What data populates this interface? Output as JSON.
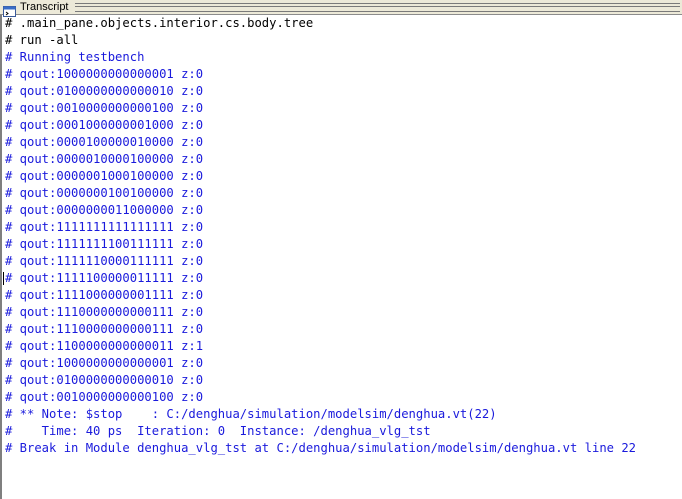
{
  "window": {
    "title": "Transcript"
  },
  "transcript": {
    "lines": [
      {
        "text": "# .main_pane.objects.interior.cs.body.tree",
        "color": "black"
      },
      {
        "text": "# run -all",
        "color": "black"
      },
      {
        "text": "# Running testbench",
        "color": "blue"
      },
      {
        "text": "# qout:1000000000000001 z:0",
        "color": "blue"
      },
      {
        "text": "# qout:0100000000000010 z:0",
        "color": "blue"
      },
      {
        "text": "# qout:0010000000000100 z:0",
        "color": "blue"
      },
      {
        "text": "# qout:0001000000001000 z:0",
        "color": "blue"
      },
      {
        "text": "# qout:0000100000010000 z:0",
        "color": "blue"
      },
      {
        "text": "# qout:0000010000100000 z:0",
        "color": "blue"
      },
      {
        "text": "# qout:0000001000100000 z:0",
        "color": "blue"
      },
      {
        "text": "# qout:0000000100100000 z:0",
        "color": "blue"
      },
      {
        "text": "# qout:0000000011000000 z:0",
        "color": "blue"
      },
      {
        "text": "# qout:1111111111111111 z:0",
        "color": "blue"
      },
      {
        "text": "# qout:1111111100111111 z:0",
        "color": "blue"
      },
      {
        "text": "# qout:1111110000111111 z:0",
        "color": "blue"
      },
      {
        "text": "# qout:1111100000011111 z:0",
        "color": "blue"
      },
      {
        "text": "# qout:1111000000001111 z:0",
        "color": "blue"
      },
      {
        "text": "# qout:1110000000000111 z:0",
        "color": "blue"
      },
      {
        "text": "# qout:1110000000000111 z:0",
        "color": "blue"
      },
      {
        "text": "# qout:1100000000000011 z:1",
        "color": "blue"
      },
      {
        "text": "# qout:1000000000000001 z:0",
        "color": "blue"
      },
      {
        "text": "# qout:0100000000000010 z:0",
        "color": "blue"
      },
      {
        "text": "# qout:0010000000000100 z:0",
        "color": "blue"
      },
      {
        "text": "# ** Note: $stop    : C:/denghua/simulation/modelsim/denghua.vt(22)",
        "color": "blue"
      },
      {
        "text": "#    Time: 40 ps  Iteration: 0  Instance: /denghua_vlg_tst",
        "color": "blue"
      },
      {
        "text": "# Break in Module denghua_vlg_tst at C:/denghua/simulation/modelsim/denghua.vt line 22",
        "color": "blue"
      }
    ]
  },
  "colors": {
    "blue": "#1a1adc",
    "black": "#000000",
    "titlebar": "#ece9d8"
  },
  "icons": {
    "title": "transcript-window-icon"
  }
}
